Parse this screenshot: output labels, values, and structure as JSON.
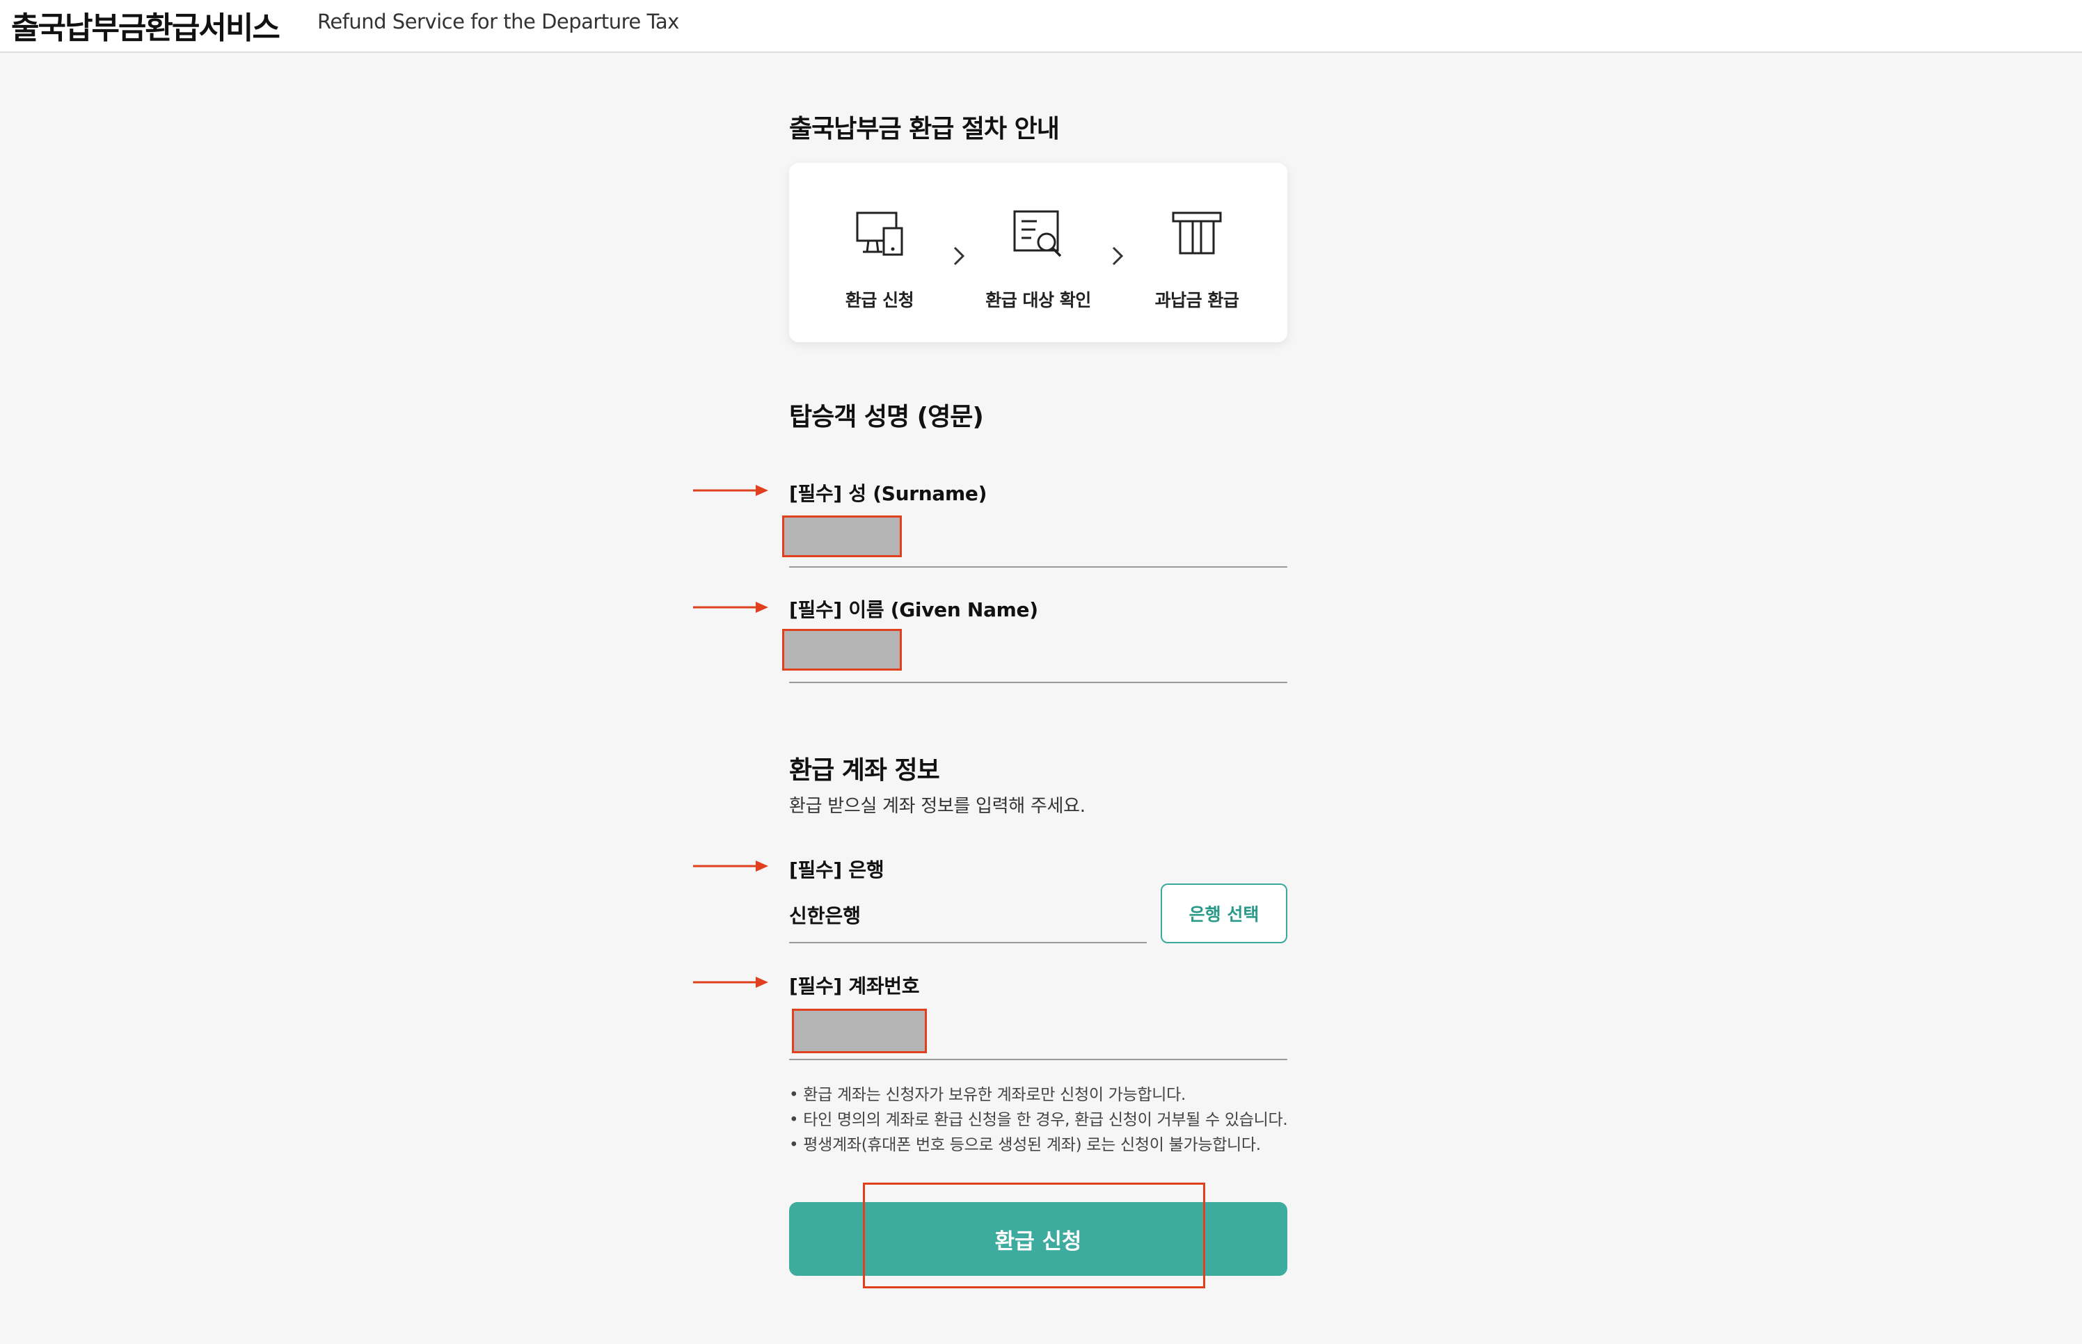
{
  "header": {
    "brand_ko": "출국납부금환급서비스",
    "brand_en": "Refund Service for the Departure Tax"
  },
  "procedure": {
    "title": "출국납부금 환급 절차 안내",
    "steps": [
      {
        "label": "환급 신청",
        "icon": "computer-tablet-icon"
      },
      {
        "label": "환급 대상 확인",
        "icon": "document-search-icon"
      },
      {
        "label": "과납금 환급",
        "icon": "refund-receipt-icon"
      }
    ]
  },
  "passenger": {
    "title": "탑승객 성명 (영문)",
    "surname_label": "[필수] 성 (Surname)",
    "given_name_label": "[필수] 이름 (Given Name)"
  },
  "account": {
    "title": "환급 계좌 정보",
    "subtitle": "환급 받으실 계좌 정보를 입력해 주세요.",
    "bank_label": "[필수] 은행",
    "bank_value": "신한은행",
    "bank_button": "은행 선택",
    "account_number_label": "[필수] 계좌번호",
    "notes": [
      "• 환급 계좌는 신청자가 보유한 계좌로만 신청이 가능합니다.",
      "• 타인 명의의 계좌로 환급 신청을 한 경우, 환급 신청이 거부될 수 있습니다.",
      "• 평생계좌(휴대폰 번호 등으로 생성된 계좌) 로는 신청이 불가능합니다."
    ]
  },
  "submit_button": "환급 신청",
  "colors": {
    "accent": "#3dab9e",
    "annotation_red": "#e0401e",
    "background": "#f6f6f6"
  }
}
